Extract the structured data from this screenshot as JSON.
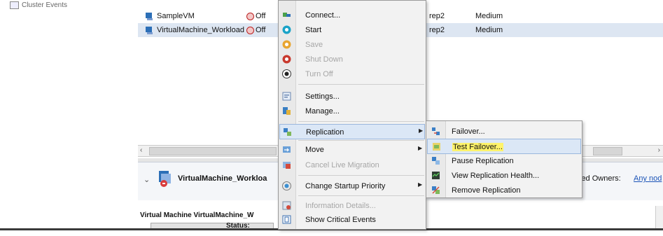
{
  "tree": {
    "item_label": "Cluster Events"
  },
  "grid": {
    "rows": [
      {
        "name": "SampleVM",
        "status": "Off",
        "col4": "rep2",
        "col5": "Medium"
      },
      {
        "name": "VirtualMachine_Workload",
        "status": "Off",
        "col4": "rep2",
        "col5": "Medium"
      }
    ]
  },
  "context_menu": {
    "items": [
      {
        "label": "Connect...",
        "icon": "connect-icon",
        "disabled": false
      },
      {
        "label": "Start",
        "icon": "start-icon",
        "disabled": false
      },
      {
        "label": "Save",
        "icon": "save-icon",
        "disabled": true
      },
      {
        "label": "Shut Down",
        "icon": "shutdown-icon",
        "disabled": true
      },
      {
        "label": "Turn Off",
        "icon": "turnoff-icon",
        "disabled": true
      },
      {
        "label": "Settings...",
        "icon": "settings-icon",
        "disabled": false
      },
      {
        "label": "Manage...",
        "icon": "manage-icon",
        "disabled": false
      },
      {
        "label": "Replication",
        "icon": "replication-icon",
        "disabled": false,
        "submenu": true
      },
      {
        "label": "Move",
        "icon": "move-icon",
        "disabled": false,
        "submenu": true
      },
      {
        "label": "Cancel Live Migration",
        "icon": "cancel-migration-icon",
        "disabled": true
      },
      {
        "label": "Change Startup Priority",
        "icon": "startup-priority-icon",
        "disabled": false,
        "submenu": true
      },
      {
        "label": "Information Details...",
        "icon": "info-details-icon",
        "disabled": true
      },
      {
        "label": "Show Critical Events",
        "icon": "critical-events-icon",
        "disabled": false
      }
    ]
  },
  "replication_submenu": {
    "items": [
      {
        "label": "Failover...",
        "icon": "failover-icon"
      },
      {
        "label": "Test Failover...",
        "icon": "test-failover-icon"
      },
      {
        "label": "Pause Replication",
        "icon": "pause-replication-icon"
      },
      {
        "label": "View Replication Health...",
        "icon": "replication-health-icon"
      },
      {
        "label": "Remove Replication",
        "icon": "remove-replication-icon"
      }
    ]
  },
  "detail": {
    "name": "VirtualMachine_Workloa",
    "preferred_owners_label": "erred Owners:",
    "preferred_owners_value": "Any nod",
    "section_title": "Virtual Machine VirtualMachine_W",
    "status_label": "Status:"
  },
  "colors": {
    "highlight": "#fff36b",
    "selection": "#dbe7f6",
    "link": "#1a53b7"
  }
}
